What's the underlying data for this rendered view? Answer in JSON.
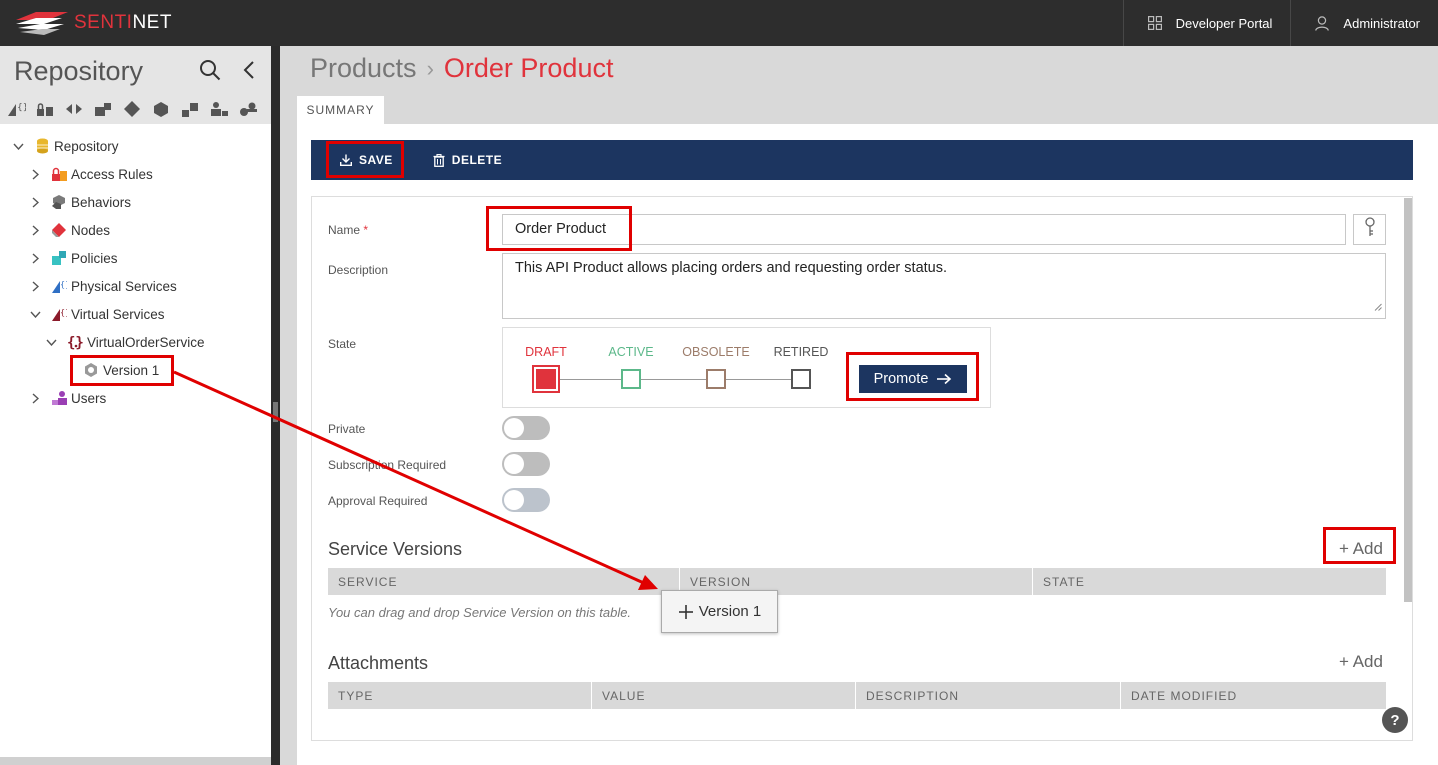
{
  "topbar": {
    "logo_text_red": "SENTI",
    "logo_text_white": "NET",
    "developer_portal": "Developer Portal",
    "user": "Administrator"
  },
  "sidebar": {
    "title": "Repository",
    "tree": [
      {
        "label": "Repository",
        "icon": "database-icon",
        "expanded": true
      },
      {
        "label": "Access Rules",
        "icon": "lock-icon"
      },
      {
        "label": "Behaviors",
        "icon": "cubes-icon"
      },
      {
        "label": "Nodes",
        "icon": "diamond-icon"
      },
      {
        "label": "Policies",
        "icon": "policies-icon"
      },
      {
        "label": "Physical Services",
        "icon": "physical-service-icon"
      },
      {
        "label": "Virtual Services",
        "icon": "virtual-service-icon",
        "expanded": true
      },
      {
        "label": "VirtualOrderService",
        "icon": "braces-icon",
        "expanded": true
      },
      {
        "label": "Version 1",
        "icon": "gear-icon"
      },
      {
        "label": "Users",
        "icon": "users-icon"
      }
    ]
  },
  "breadcrumb": {
    "parent": "Products",
    "separator": "›",
    "current": "Order Product"
  },
  "tabs": {
    "summary": "SUMMARY"
  },
  "toolbar": {
    "save": "SAVE",
    "delete": "DELETE"
  },
  "form": {
    "name_label": "Name",
    "required_mark": "*",
    "name_value": "Order Product",
    "description_label": "Description",
    "description_value": "This API Product allows placing orders and requesting order status.",
    "state_label": "State",
    "states": [
      "DRAFT",
      "ACTIVE",
      "OBSOLETE",
      "RETIRED"
    ],
    "current_state": "DRAFT",
    "promote": "Promote",
    "private_label": "Private",
    "subscription_label": "Subscription Required",
    "approval_label": "Approval Required",
    "private_on": false,
    "subscription_on": false,
    "approval_on": false
  },
  "service_versions": {
    "title": "Service Versions",
    "add": "+ Add",
    "columns": [
      "SERVICE",
      "VERSION",
      "STATE"
    ],
    "hint": "You can drag and drop Service Version on this table."
  },
  "attachments": {
    "title": "Attachments",
    "add": "+ Add",
    "columns": [
      "TYPE",
      "VALUE",
      "DESCRIPTION",
      "DATE MODIFIED"
    ]
  },
  "drag_ghost": {
    "label": "Version 1"
  },
  "help": "?",
  "colors": {
    "brand_red": "#e0333c",
    "navy": "#1c3560",
    "topbar": "#2d2d2d",
    "annotation": "#e00000",
    "active_green": "#5cb88a",
    "obsolete_brown": "#9c7c6a"
  }
}
